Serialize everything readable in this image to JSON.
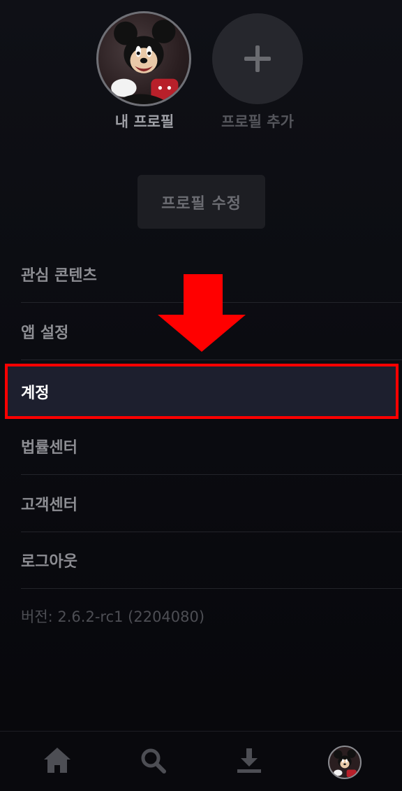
{
  "profiles": {
    "mine_label": "내 프로필",
    "add_label": "프로필 추가",
    "avatar_icon": "mickey-avatar-icon",
    "add_icon": "plus-icon"
  },
  "edit_button_label": "프로필 수정",
  "menu": {
    "items": [
      {
        "label": "관심 콘텐츠"
      },
      {
        "label": "앱 설정"
      },
      {
        "label": "계정"
      },
      {
        "label": "법률센터"
      },
      {
        "label": "고객센터"
      },
      {
        "label": "로그아웃"
      }
    ],
    "highlighted_index": 2
  },
  "version_text": "버전: 2.6.2-rc1 (2204080)",
  "bottom_nav": {
    "items": [
      {
        "icon": "home-icon"
      },
      {
        "icon": "search-icon"
      },
      {
        "icon": "download-icon"
      },
      {
        "icon": "profile-avatar-icon"
      }
    ]
  },
  "colors": {
    "background": "#0b0c11",
    "highlight_border": "#ff0000",
    "highlight_fill": "#1d1f2e",
    "arrow": "#ff0000"
  }
}
